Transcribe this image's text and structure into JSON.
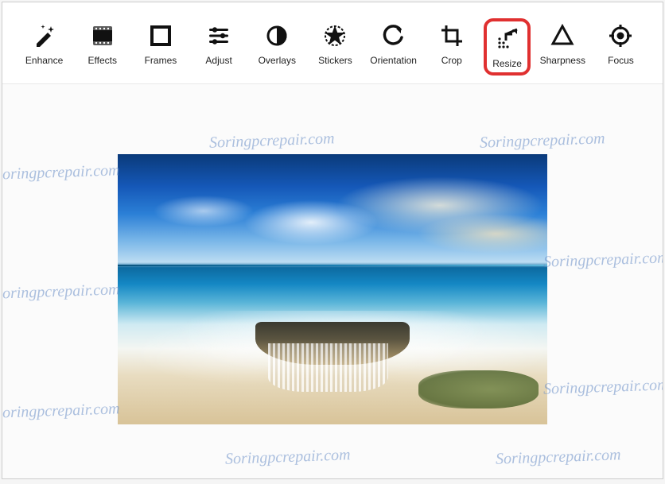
{
  "toolbar": {
    "items": [
      {
        "label": "Enhance",
        "icon": "enhance",
        "highlighted": false
      },
      {
        "label": "Effects",
        "icon": "effects",
        "highlighted": false
      },
      {
        "label": "Frames",
        "icon": "frames",
        "highlighted": false
      },
      {
        "label": "Adjust",
        "icon": "adjust",
        "highlighted": false
      },
      {
        "label": "Overlays",
        "icon": "overlays",
        "highlighted": false
      },
      {
        "label": "Stickers",
        "icon": "stickers",
        "highlighted": false
      },
      {
        "label": "Orientation",
        "icon": "orientation",
        "highlighted": false
      },
      {
        "label": "Crop",
        "icon": "crop",
        "highlighted": false
      },
      {
        "label": "Resize",
        "icon": "resize",
        "highlighted": true
      },
      {
        "label": "Sharpness",
        "icon": "sharpness",
        "highlighted": false
      },
      {
        "label": "Focus",
        "icon": "focus",
        "highlighted": false
      }
    ]
  },
  "watermark_text": "Soringpcrepair.com",
  "highlight_color": "#e03030"
}
